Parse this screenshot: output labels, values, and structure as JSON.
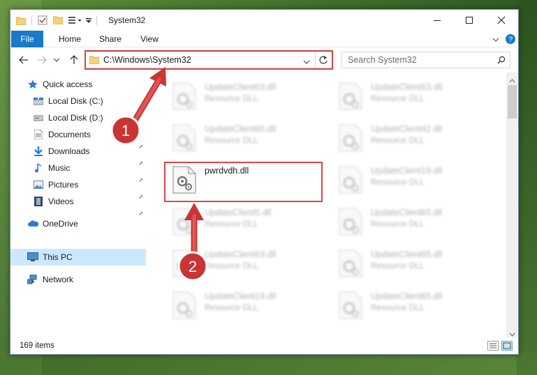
{
  "window": {
    "title": "System32",
    "controls": [
      "minimize",
      "maximize",
      "close"
    ]
  },
  "ribbon": {
    "tabs": [
      "File",
      "Home",
      "Share",
      "View"
    ]
  },
  "address": {
    "path": "C:\\Windows\\System32",
    "search_placeholder": "Search System32"
  },
  "nav_pane": {
    "items": [
      {
        "label": "Quick access",
        "icon": "star-icon",
        "pinned": false
      },
      {
        "label": "Local Disk (C:)",
        "icon": "drive-icon",
        "pinned": true
      },
      {
        "label": "Local Disk (D:)",
        "icon": "drive-icon",
        "pinned": true
      },
      {
        "label": "Documents",
        "icon": "documents-icon",
        "pinned": true
      },
      {
        "label": "Downloads",
        "icon": "download-icon",
        "pinned": true
      },
      {
        "label": "Music",
        "icon": "music-icon",
        "pinned": true
      },
      {
        "label": "Pictures",
        "icon": "pictures-icon",
        "pinned": true
      },
      {
        "label": "Videos",
        "icon": "videos-icon",
        "pinned": true
      },
      {
        "label": "OneDrive",
        "icon": "cloud-icon",
        "pinned": false
      },
      {
        "label": "This PC",
        "icon": "computer-icon",
        "pinned": false,
        "selected": true
      },
      {
        "label": "Network",
        "icon": "network-icon",
        "pinned": false
      }
    ]
  },
  "files": {
    "left": [
      {
        "name": "UpdateClient63.dll",
        "type": "Resource DLL"
      },
      {
        "name": "UpdateClient65.dll",
        "type": "Resource DLL"
      },
      {
        "name": "pwrdvdh.dll",
        "type": ""
      },
      {
        "name": "UpdateClient5.dll",
        "type": "Resource DLL"
      },
      {
        "name": "UpdateClient63.dll",
        "type": "Resource DLL"
      },
      {
        "name": "UpdateClient19.dll",
        "type": "Resource DLL"
      }
    ],
    "right": [
      {
        "name": "UpdateClient63.dll",
        "type": "Resource DLL"
      },
      {
        "name": "UpdateClient42.dll",
        "type": "Resource DLL"
      },
      {
        "name": "UpdateClient19.dll",
        "type": "Resource DLL"
      },
      {
        "name": "UpdateClient65.dll",
        "type": "Resource DLL"
      },
      {
        "name": "UpdateClient65.dll",
        "type": "Resource DLL"
      },
      {
        "name": "UpdateClient65.dll",
        "type": "Resource DLL"
      }
    ]
  },
  "status": {
    "item_count": "169 items"
  },
  "annotations": {
    "step1": "1",
    "step2": "2"
  },
  "colors": {
    "accent": "#1979ca",
    "annotation_red": "#d94545",
    "selection": "#cce8ff"
  }
}
